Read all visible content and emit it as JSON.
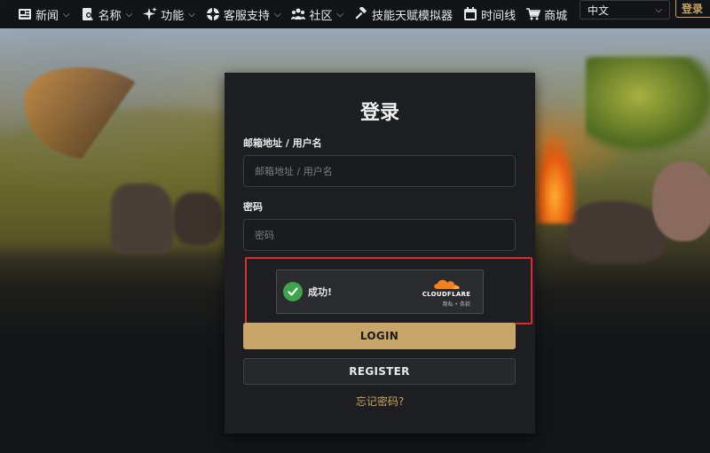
{
  "nav": {
    "items": [
      {
        "label": "新闻",
        "icon": "news-icon",
        "dropdown": true
      },
      {
        "label": "名称",
        "icon": "search-book-icon",
        "dropdown": true
      },
      {
        "label": "功能",
        "icon": "sparkle-icon",
        "dropdown": true
      },
      {
        "label": "客服支持",
        "icon": "lifebuoy-icon",
        "dropdown": true
      },
      {
        "label": "社区",
        "icon": "people-icon",
        "dropdown": true
      },
      {
        "label": "技能天赋模拟器",
        "icon": "hammer-icon",
        "dropdown": false
      },
      {
        "label": "时间线",
        "icon": "calendar-icon",
        "dropdown": false
      },
      {
        "label": "商城",
        "icon": "cart-icon",
        "dropdown": false
      }
    ],
    "language": "中文",
    "login_button": "登录"
  },
  "login": {
    "title": "登录",
    "email_label": "邮箱地址 / 用户名",
    "email_placeholder": "邮箱地址 / 用户名",
    "password_label": "密码",
    "password_placeholder": "密码",
    "captcha": {
      "status": "成功!",
      "provider": "CLOUDFLARE",
      "links": "隐私 • 条款"
    },
    "login_button": "LOGIN",
    "register_button": "REGISTER",
    "forgot_password": "忘记密码?"
  },
  "colors": {
    "accent": "#c8a66a",
    "highlight_border": "#e0282e",
    "success": "#3fa34d",
    "cloudflare": "#f38020"
  }
}
